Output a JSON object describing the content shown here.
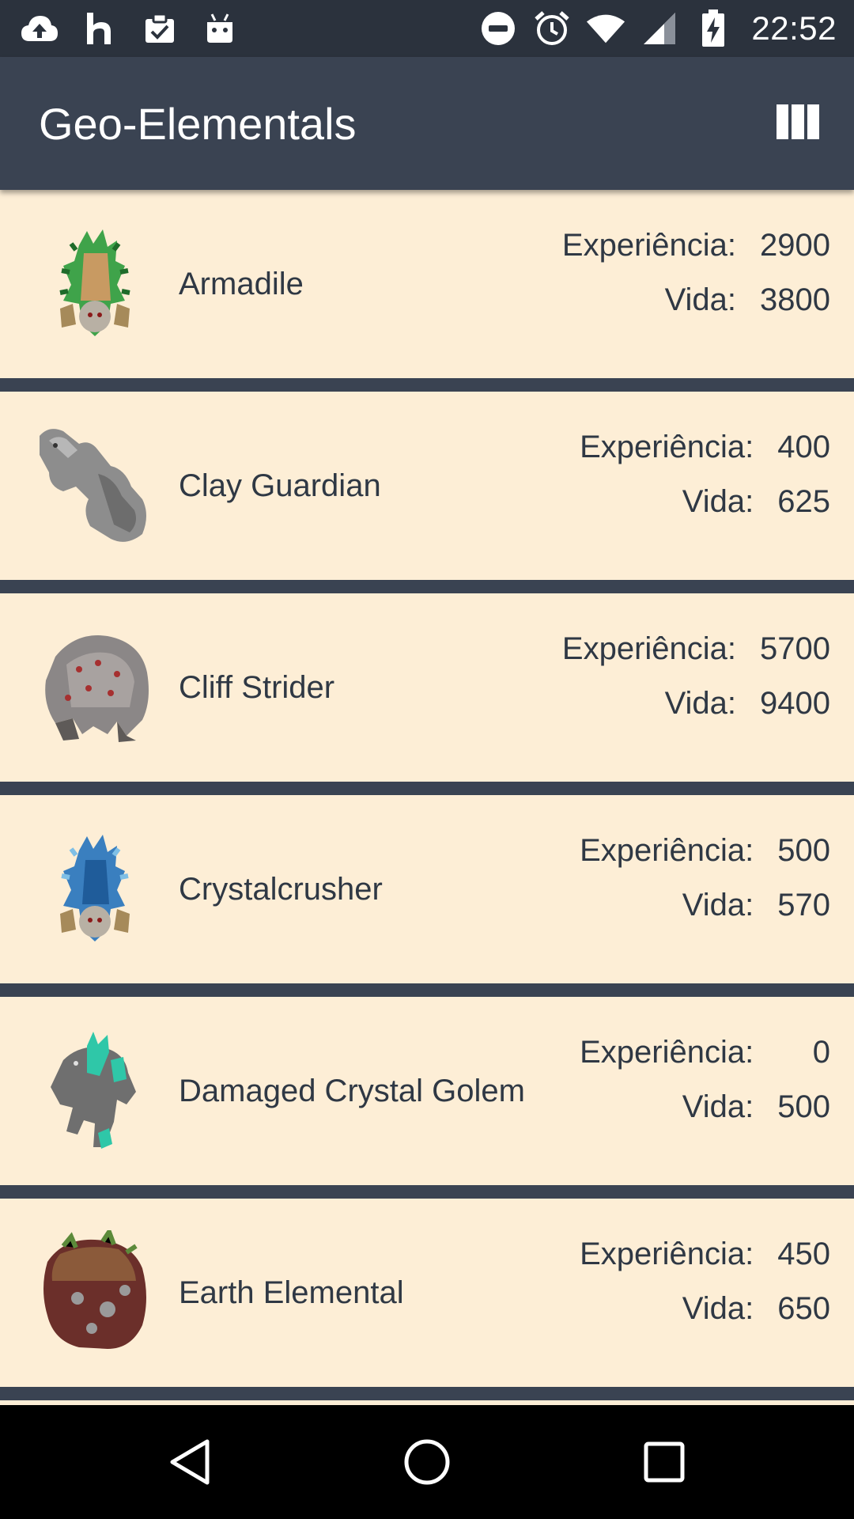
{
  "status_bar": {
    "time": "22:52",
    "icons_left": [
      "cloud-upload-icon",
      "h-app-icon",
      "clipboard-check-icon",
      "android-icon"
    ],
    "icons_right": [
      "do-not-disturb-icon",
      "alarm-icon",
      "wifi-icon",
      "signal-icon",
      "battery-charging-icon"
    ]
  },
  "app_bar": {
    "title": "Geo-Elementals",
    "action_icon": "view-columns-icon"
  },
  "creatures": [
    {
      "name": "Armadile",
      "exp_label": "Experiência:",
      "exp": "2900",
      "life_label": "Vida:",
      "life": "3800",
      "image": "armadile-sprite"
    },
    {
      "name": "Clay Guardian",
      "exp_label": "Experiência:",
      "exp": "400",
      "life_label": "Vida:",
      "life": "625",
      "image": "clay-guardian-sprite"
    },
    {
      "name": "Cliff Strider",
      "exp_label": "Experiência:",
      "exp": "5700",
      "life_label": "Vida:",
      "life": "9400",
      "image": "cliff-strider-sprite"
    },
    {
      "name": "Crystalcrusher",
      "exp_label": "Experiência:",
      "exp": "500",
      "life_label": "Vida:",
      "life": "570",
      "image": "crystalcrusher-sprite"
    },
    {
      "name": "Damaged Crystal Golem",
      "exp_label": "Experiência:",
      "exp": "0",
      "life_label": "Vida:",
      "life": "500",
      "image": "damaged-crystal-golem-sprite"
    },
    {
      "name": "Earth Elemental",
      "exp_label": "Experiência:",
      "exp": "450",
      "life_label": "Vida:",
      "life": "650",
      "image": "earth-elemental-sprite"
    }
  ],
  "nav_bar": {
    "back": "back-icon",
    "home": "home-icon",
    "recents": "recents-icon"
  }
}
